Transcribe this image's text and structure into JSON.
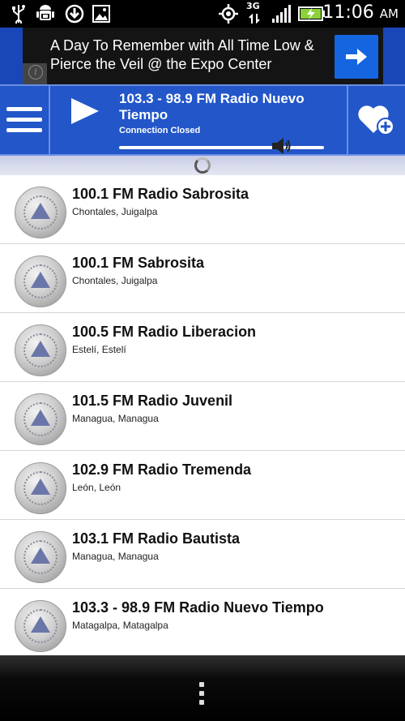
{
  "status_bar": {
    "time": "11:06",
    "am_pm": "AM",
    "network_type": "3G",
    "icons": [
      "usb-icon",
      "android-debug-icon",
      "download-icon",
      "image-icon",
      "gps-icon",
      "signal-icon",
      "battery-charging-icon"
    ]
  },
  "ad": {
    "text": "A Day To Remember with All Time Low & Pierce the Veil @ the Expo Center",
    "info_label": "i",
    "arrow_icon": "arrow-right-icon"
  },
  "player": {
    "station_title": "103.3 - 98.9 FM Radio Nuevo Tiempo",
    "status": "Connection Closed",
    "volume_level": 0.79,
    "menu_icon": "hamburger-menu-icon",
    "play_icon": "play-icon",
    "favorite_icon": "add-favorite-icon",
    "volume_icon": "speaker-icon"
  },
  "stations": [
    {
      "name": "100.1 FM Radio Sabrosita",
      "region": "Chontales",
      "city": "Juigalpa"
    },
    {
      "name": "100.1 FM Sabrosita",
      "region": "Chontales",
      "city": "Juigalpa"
    },
    {
      "name": "100.5 FM Radio Liberacion",
      "region": "Estelí",
      "city": "Estelí"
    },
    {
      "name": "101.5 FM Radio Juvenil",
      "region": "Managua",
      "city": "Managua"
    },
    {
      "name": "102.9 FM Radio Tremenda",
      "region": "León",
      "city": "León"
    },
    {
      "name": "103.1 FM Radio Bautista",
      "region": "Managua",
      "city": "Managua"
    },
    {
      "name": "103.3 - 98.9 FM Radio Nuevo Tiempo",
      "region": "Matagalpa",
      "city": "Matagalpa"
    }
  ],
  "colors": {
    "accent": "#2256c9",
    "ad_button": "#1565e0",
    "list_background": "#ffffff"
  }
}
